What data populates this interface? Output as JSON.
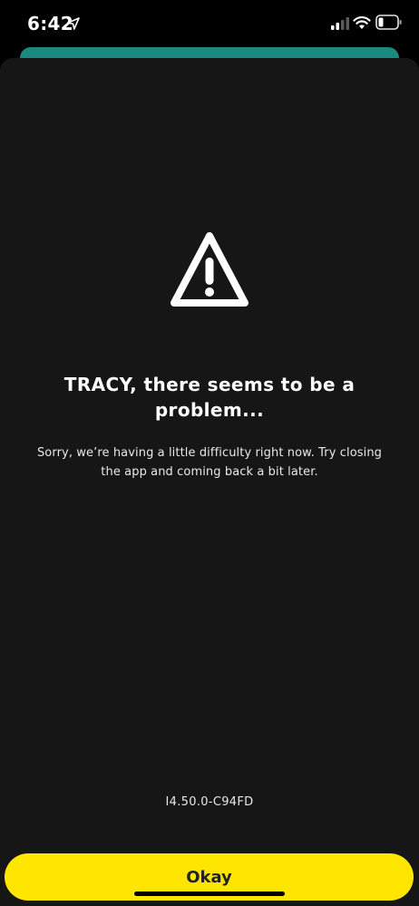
{
  "status_bar": {
    "time": "6:42",
    "icons": [
      "location-arrow-icon",
      "cellular-signal-icon",
      "wifi-icon",
      "battery-icon"
    ]
  },
  "error": {
    "icon": "warning-triangle-icon",
    "title": "TRACY, there seems to be a problem...",
    "message": "Sorry, we’re having a little difficulty right now. Try closing the app and coming back a bit later."
  },
  "footer": {
    "version": "I4.50.0-C94FD",
    "okay_label": "Okay"
  },
  "colors": {
    "background": "#161616",
    "accent_button": "#ffe600",
    "behind_card": "#1a8a80"
  }
}
